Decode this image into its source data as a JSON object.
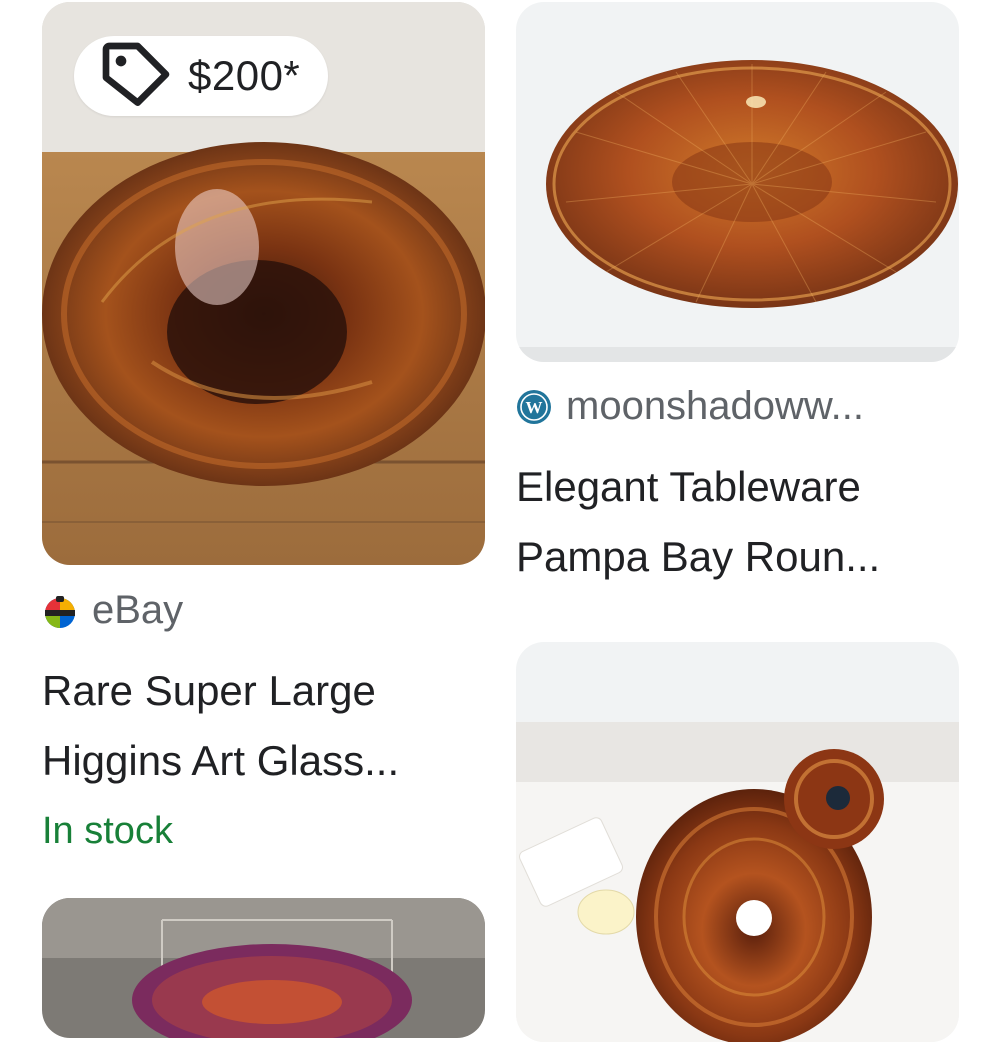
{
  "results": [
    {
      "price": "$200*",
      "source": "eBay",
      "title": "Rare Super Large\nHiggins Art Glass...",
      "availability": "In stock"
    },
    {
      "source": "moonshadoww...",
      "title": "Elegant Tableware\nPampa Bay Roun..."
    }
  ],
  "icons": {
    "price_tag": "tag-icon",
    "ebay_favicon": "ebay-favicon-icon",
    "wordpress_favicon": "wordpress-favicon-icon"
  },
  "colors": {
    "text_primary": "#202124",
    "text_secondary": "#5f6368",
    "in_stock": "#188038",
    "image_bg": "#f1f3f4"
  }
}
